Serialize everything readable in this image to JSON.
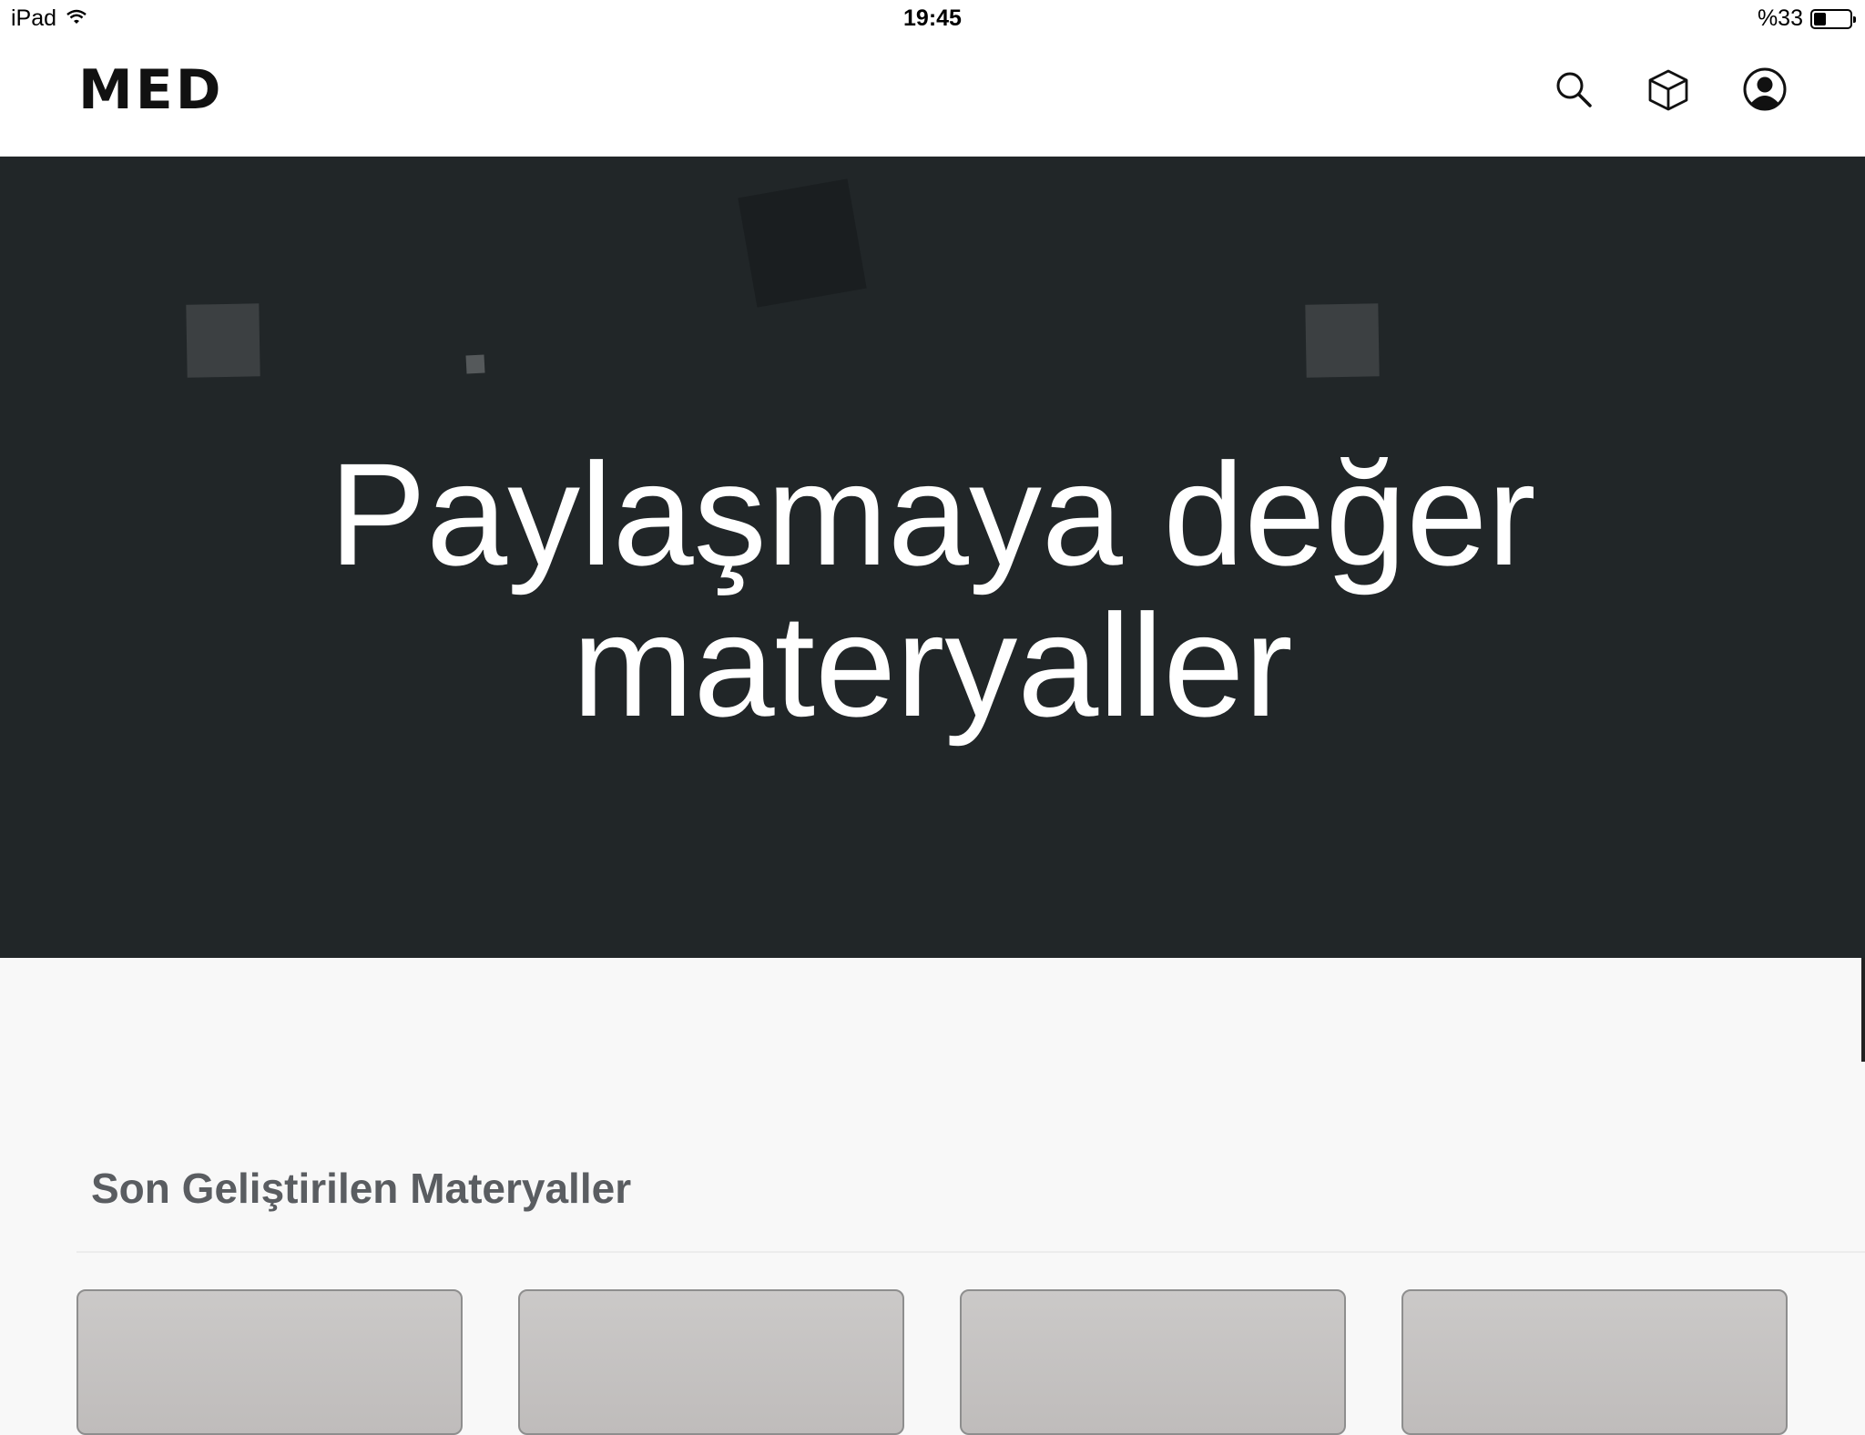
{
  "status_bar": {
    "device": "iPad",
    "time": "19:45",
    "battery": "%33",
    "battery_level": 0.33
  },
  "navbar": {
    "logo": "MED",
    "icons": [
      "search-icon",
      "cube-icon",
      "account-icon"
    ]
  },
  "hero": {
    "title_line1": "Paylaşmaya değer",
    "title_line2": "materyaller"
  },
  "section": {
    "title": "Son Geliştirilen Materyaller",
    "card_count": 4
  },
  "colors": {
    "hero_bg": "#212628",
    "page_bg": "#f8f8f8",
    "section_title": "#5a5d61",
    "card_bg": "#c6c4c3"
  }
}
